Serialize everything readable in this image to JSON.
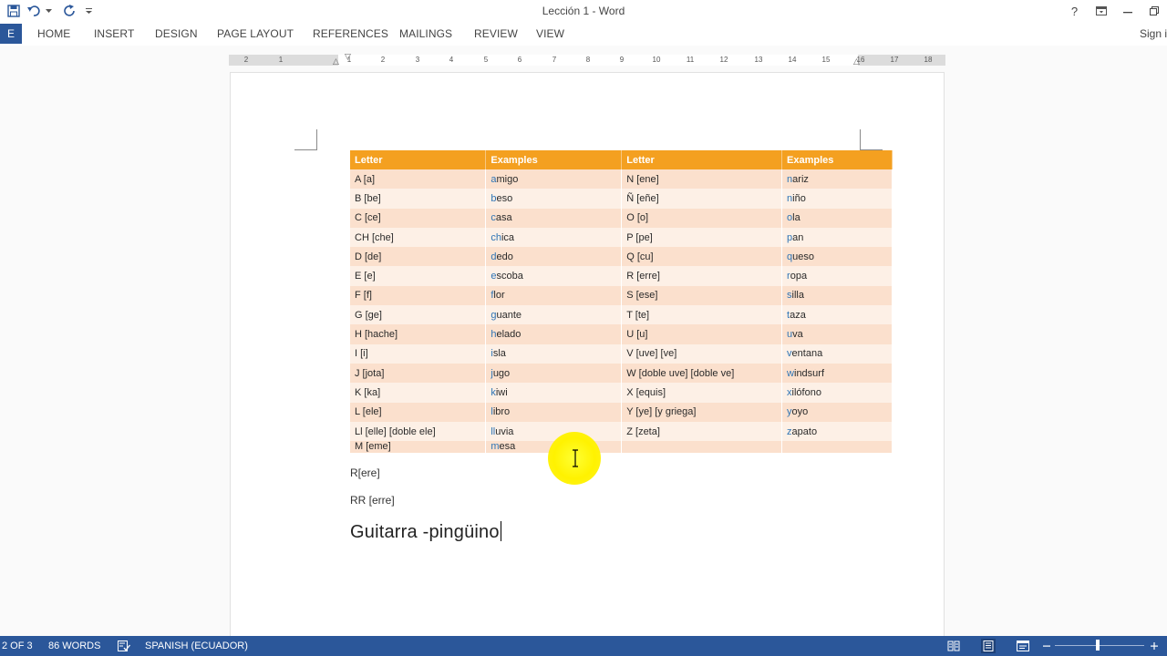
{
  "titlebar": {
    "title": "Lección 1 - Word",
    "help": "?"
  },
  "ribbon": {
    "file_label": "E",
    "tabs": [
      "HOME",
      "INSERT",
      "DESIGN",
      "PAGE LAYOUT",
      "REFERENCES",
      "MAILINGS",
      "REVIEW",
      "VIEW"
    ],
    "signin": "Sign i"
  },
  "ruler": {
    "marks": [
      "2",
      "1",
      "1",
      "2",
      "3",
      "4",
      "5",
      "6",
      "7",
      "8",
      "9",
      "10",
      "11",
      "12",
      "13",
      "14",
      "15",
      "16",
      "17",
      "18"
    ]
  },
  "table": {
    "headers": [
      "Letter",
      "Examples",
      "Letter",
      "Examples"
    ],
    "rows": [
      [
        "A  [a]",
        "amigo",
        "N  [ene]",
        "nariz"
      ],
      [
        "B  [be]",
        "beso",
        "Ñ  [eñe]",
        "niño"
      ],
      [
        "C  [ce]",
        "casa",
        "O  [o]",
        "ola"
      ],
      [
        "CH [che]",
        "chica",
        "P  [pe]",
        "pan"
      ],
      [
        "D  [de]",
        "dedo",
        "Q  [cu]",
        "queso"
      ],
      [
        "E  [e]",
        "escoba",
        "R  [erre]",
        "ropa"
      ],
      [
        "F  [f]",
        "flor",
        "S  [ese]",
        "silla"
      ],
      [
        "G  [ge]",
        "guante",
        "T  [te]",
        "taza"
      ],
      [
        "H  [hache]",
        "helado",
        "U  [u]",
        "uva"
      ],
      [
        "I  [i]",
        "isla",
        "V [uve] [ve]",
        "ventana"
      ],
      [
        "J  [jota]",
        "jugo",
        "W [doble uve] [doble ve]",
        "windsurf"
      ],
      [
        "K  [ka]",
        "kiwi",
        "X  [equis]",
        "xilófono"
      ],
      [
        "L  [ele]",
        "libro",
        "Y  [ye] [y griega]",
        "yoyo"
      ],
      [
        "Ll [elle] [doble ele]",
        "lluvia",
        "Z  [zeta]",
        "zapato"
      ],
      [
        "M [eme]",
        "mesa",
        "",
        ""
      ]
    ]
  },
  "paragraphs": {
    "p1": "R[ere]",
    "p2": "RR [erre]",
    "heading": "Guitarra -pingüino"
  },
  "statusbar": {
    "page": "2 OF 3",
    "words": "86 WORDS",
    "language": "SPANISH (ECUADOR)"
  },
  "colors": {
    "accent": "#2b579a",
    "table_header": "#f4a020",
    "row_odd": "#fbe0cd",
    "row_even": "#fdf0e6",
    "cursor_highlight": "#fff200"
  },
  "icons": [
    "save-icon",
    "undo-icon",
    "redo-icon",
    "customize-qat-icon",
    "help-icon",
    "ribbon-display-icon",
    "minimize-icon",
    "restore-icon",
    "proofing-icon",
    "read-mode-icon",
    "print-layout-icon",
    "web-layout-icon",
    "zoom-out-icon",
    "zoom-in-icon"
  ]
}
